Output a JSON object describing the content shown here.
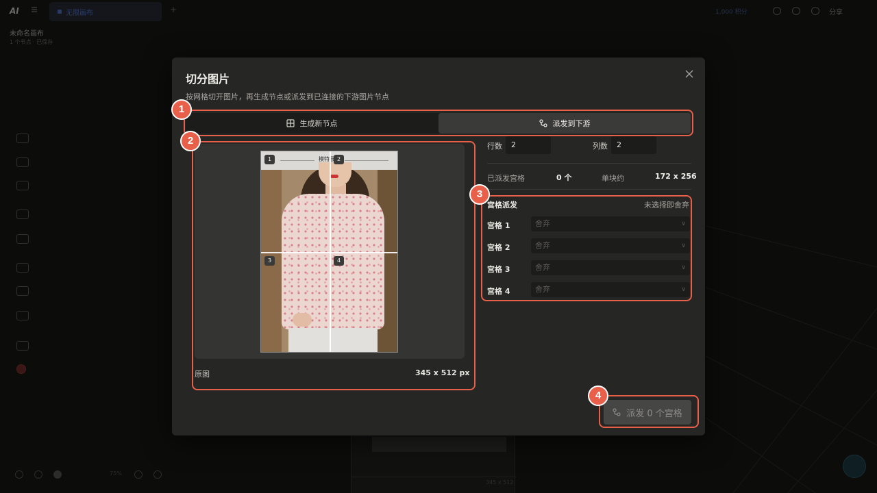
{
  "background": {
    "logo": "AI",
    "tab_title": "无限画布",
    "credits": "1,000 积分",
    "share": "分享",
    "project_title": "未命名画布",
    "project_subtitle": "1 个节点 · 已保存",
    "zoom": "75%",
    "card_caption": "345 x 512"
  },
  "modal": {
    "title": "切分图片",
    "subtitle": "按网格切开图片，再生成节点或派发到已连接的下游图片节点",
    "close_icon": "close-icon",
    "tabs": [
      {
        "label": "生成新节点",
        "icon": "grid-icon",
        "active": false
      },
      {
        "label": "派发到下游",
        "icon": "link-nodes-icon",
        "active": true
      }
    ],
    "preview": {
      "banner_text": "模特展示",
      "cell_labels": [
        "1",
        "2",
        "3",
        "4"
      ],
      "label": "原图",
      "size": "345 x 512 px"
    },
    "grid": {
      "rows_label": "行数",
      "rows_value": "2",
      "cols_label": "列数",
      "cols_value": "2"
    },
    "stats": {
      "dispatched_label": "已派发宫格",
      "dispatched_value": "0 个",
      "block_label": "单块约",
      "block_value": "172 x 256"
    },
    "dispatch": {
      "title": "宫格派发",
      "hint": "未选择即舍弃",
      "rows": [
        {
          "label": "宫格 1",
          "value": "舍弃"
        },
        {
          "label": "宫格 2",
          "value": "舍弃"
        },
        {
          "label": "宫格 3",
          "value": "舍弃"
        },
        {
          "label": "宫格 4",
          "value": "舍弃"
        }
      ]
    },
    "action_button": "派发 0 个宫格"
  },
  "annotations": [
    "1",
    "2",
    "3",
    "4"
  ],
  "colors": {
    "annotation": "#e8604a",
    "modal_bg": "#262624",
    "active_tab": "#3a3a38"
  }
}
